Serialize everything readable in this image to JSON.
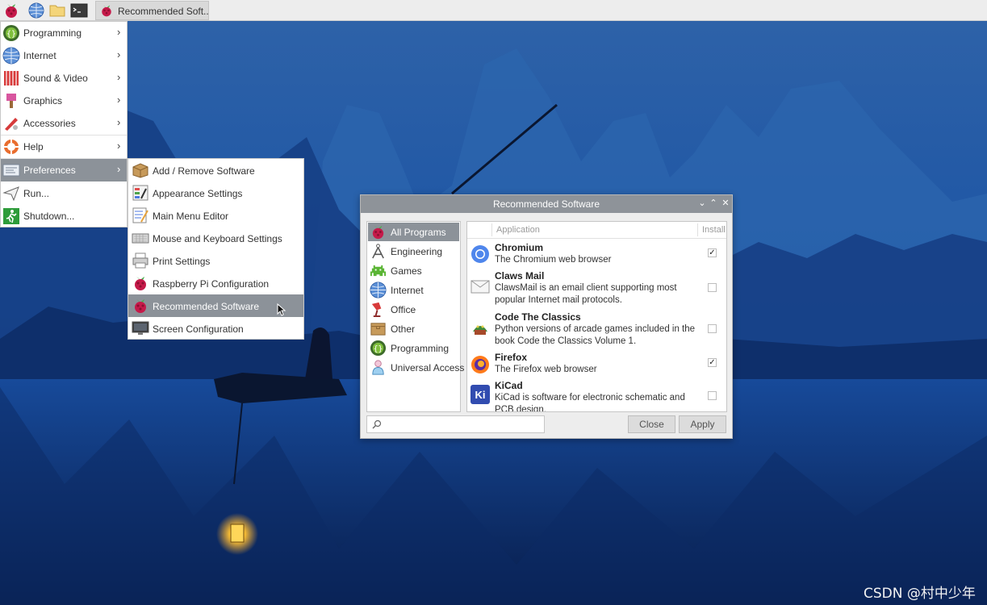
{
  "taskbar": {
    "launchers": [
      "raspberry-menu-icon",
      "web-browser-icon",
      "file-manager-icon",
      "terminal-icon"
    ],
    "task_label": "Recommended Soft.."
  },
  "main_menu": {
    "items": [
      {
        "label": "Programming",
        "icon": "programming-icon",
        "submenu": true
      },
      {
        "label": "Internet",
        "icon": "internet-icon",
        "submenu": true
      },
      {
        "label": "Sound & Video",
        "icon": "sound-video-icon",
        "submenu": true
      },
      {
        "label": "Graphics",
        "icon": "graphics-icon",
        "submenu": true
      },
      {
        "label": "Accessories",
        "icon": "accessories-icon",
        "submenu": true
      },
      {
        "label": "Help",
        "icon": "help-icon",
        "submenu": true
      },
      {
        "label": "Preferences",
        "icon": "preferences-icon",
        "submenu": true,
        "active": true
      },
      {
        "label": "Run...",
        "icon": "run-icon",
        "submenu": false
      },
      {
        "label": "Shutdown...",
        "icon": "shutdown-icon",
        "submenu": false
      }
    ]
  },
  "preferences_menu": {
    "items": [
      {
        "label": "Add / Remove Software",
        "icon": "package-icon"
      },
      {
        "label": "Appearance Settings",
        "icon": "appearance-icon"
      },
      {
        "label": "Main Menu Editor",
        "icon": "menu-editor-icon"
      },
      {
        "label": "Mouse and Keyboard Settings",
        "icon": "keyboard-icon"
      },
      {
        "label": "Print Settings",
        "icon": "printer-icon"
      },
      {
        "label": "Raspberry Pi Configuration",
        "icon": "raspberry-icon"
      },
      {
        "label": "Recommended Software",
        "icon": "raspberry-icon",
        "active": true
      },
      {
        "label": "Screen Configuration",
        "icon": "monitor-icon"
      }
    ]
  },
  "window": {
    "title": "Recommended Software",
    "categories": [
      {
        "label": "All Programs",
        "icon": "raspberry-icon",
        "active": true
      },
      {
        "label": "Engineering",
        "icon": "compass-icon"
      },
      {
        "label": "Games",
        "icon": "games-icon"
      },
      {
        "label": "Internet",
        "icon": "globe-icon"
      },
      {
        "label": "Office",
        "icon": "office-icon"
      },
      {
        "label": "Other",
        "icon": "box-icon"
      },
      {
        "label": "Programming",
        "icon": "programming-icon"
      },
      {
        "label": "Universal Access",
        "icon": "accessibility-icon"
      }
    ],
    "columns": {
      "application": "Application",
      "install": "Install"
    },
    "apps": [
      {
        "name": "Chromium",
        "desc": "The Chromium web browser",
        "icon": "chromium-icon",
        "installed": true
      },
      {
        "name": "Claws Mail",
        "desc": "ClawsMail is an email client supporting most popular Internet mail protocols.",
        "icon": "mail-icon",
        "installed": false
      },
      {
        "name": "Code The Classics",
        "desc": "Python versions of arcade games included in the book Code the Classics Volume 1.",
        "icon": "code-classics-icon",
        "installed": false
      },
      {
        "name": "Firefox",
        "desc": "The Firefox web browser",
        "icon": "firefox-icon",
        "installed": true
      },
      {
        "name": "KiCad",
        "desc": "KiCad is software for electronic schematic and PCB design.",
        "icon": "kicad-icon",
        "installed": false
      }
    ],
    "search_placeholder": "",
    "buttons": {
      "close": "Close",
      "apply": "Apply"
    }
  },
  "watermark": "CSDN @村中少年",
  "colors": {
    "menu_highlight": "#8c9299",
    "titlebar": "#8e9399",
    "taskbar": "#ededed",
    "wallpaper": "#0f3d86"
  }
}
